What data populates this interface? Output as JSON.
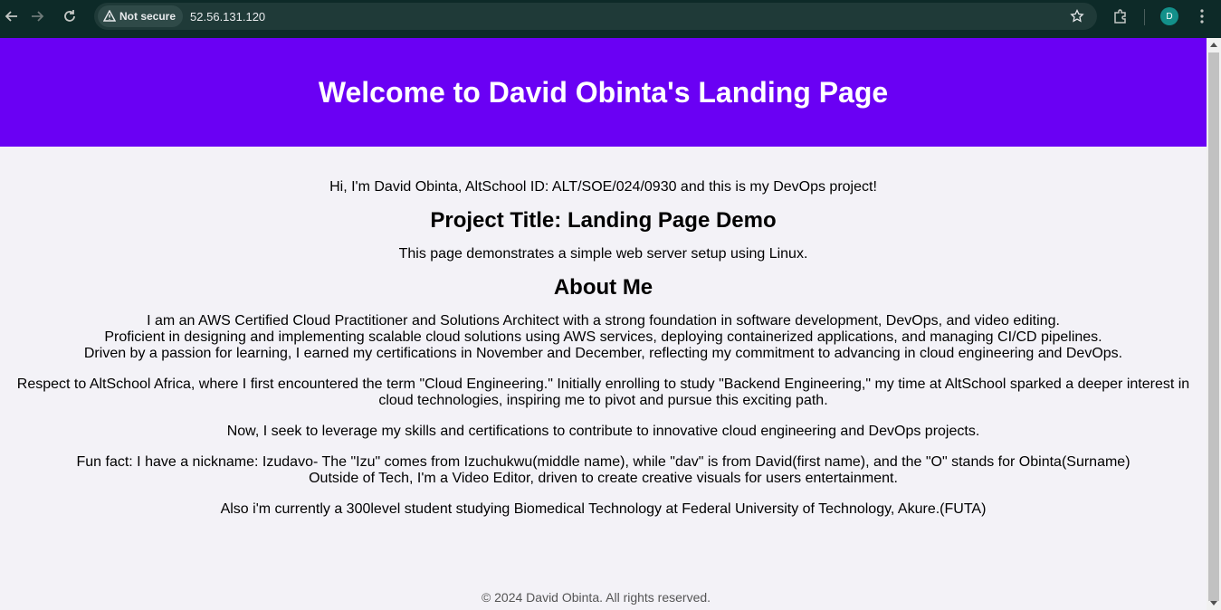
{
  "browser": {
    "security_label": "Not secure",
    "url": "52.56.131.120",
    "avatar_letter": "D",
    "icons": [
      "back-arrow-icon",
      "forward-arrow-icon",
      "reload-icon",
      "warning-triangle-icon",
      "star-icon",
      "extensions-puzzle-icon",
      "kebab-menu-icon"
    ],
    "chrome_color": "#0d2a28"
  },
  "page": {
    "hero": {
      "title": "Welcome to David Obinta's Landing Page",
      "bg_color": "#6a00f4"
    },
    "intro": "Hi, I'm David Obinta, AltSchool ID: ALT/SOE/024/0930 and this is my DevOps project!",
    "project_title": "Project Title: Landing Page Demo",
    "project_desc": "This page demonstrates a simple web server setup using Linux.",
    "about_heading": "About Me",
    "about_lines": [
      "I am an AWS Certified Cloud Practitioner and Solutions Architect with a strong foundation in software development, DevOps, and video editing.",
      "Proficient in designing and implementing scalable cloud solutions using AWS services, deploying containerized applications, and managing CI/CD pipelines.",
      "Driven by a passion for learning, I earned my certifications in November and December, reflecting my commitment to advancing in cloud engineering and DevOps."
    ],
    "respect_paragraph": "Respect to AltSchool Africa, where I first encountered the term \"Cloud Engineering.\" Initially enrolling to study \"Backend Engineering,\" my time at AltSchool sparked a deeper interest in cloud technologies, inspiring me to pivot and pursue this exciting path.",
    "now_paragraph": "Now, I seek to leverage my skills and certifications to contribute to innovative cloud engineering and DevOps projects.",
    "fun_fact_lines": [
      "Fun fact: I have a nickname: Izudavo- The \"Izu\" comes from Izuchukwu(middle name), while \"dav\" is from David(first name), and the \"O\" stands for Obinta(Surname)",
      "Outside of Tech, I'm a Video Editor, driven to create creative visuals for users entertainment."
    ],
    "student_paragraph": "Also i'm currently a 300level student studying Biomedical Technology at Federal University of Technology, Akure.(FUTA)",
    "footer": "© 2024 David Obinta. All rights reserved."
  }
}
